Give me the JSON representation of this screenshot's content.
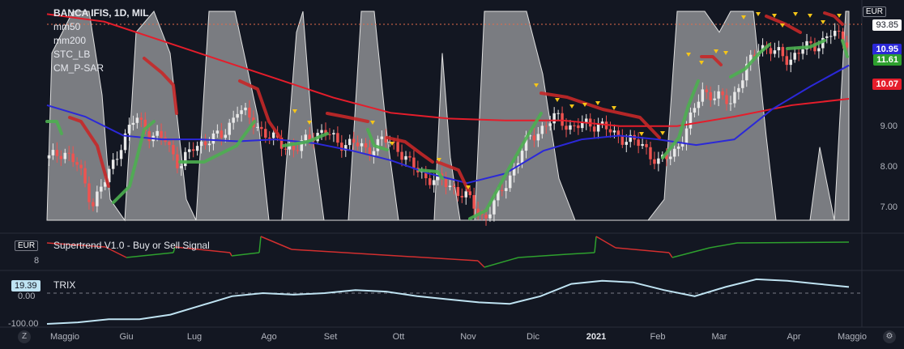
{
  "chart_data": [
    {
      "type": "candlestick",
      "title": "BANCA IFIS, 1D, MIL",
      "currency": "EUR",
      "indicators": [
        "mm50",
        "mm200",
        "STC_LB",
        "CM_P-SAR"
      ],
      "x_ticks": [
        "Maggio",
        "Giu",
        "Lug",
        "Ago",
        "Set",
        "Ott",
        "Nov",
        "Dic",
        "2021",
        "Feb",
        "Mar",
        "Apr",
        "Maggio"
      ],
      "y_ticks": [
        "7.00",
        "8.00",
        "9.00",
        "10.00"
      ],
      "ylim": [
        6.7,
        12.5
      ],
      "last_price": "11.61",
      "mm50_last": "10.95",
      "mm200_last": "10.07",
      "stc_last": "93.85",
      "price_path": [
        8.5,
        8.7,
        8.3,
        7.3,
        8.0,
        8.9,
        9.6,
        9.1,
        9.0,
        8.3,
        8.8,
        9.0,
        9.1,
        9.8,
        9.5,
        9.1,
        8.9,
        8.7,
        9.1,
        9.2,
        8.9,
        8.9,
        8.7,
        9.0,
        8.8,
        8.3,
        8.0,
        7.9,
        7.7,
        7.4,
        6.9,
        7.5,
        8.2,
        9.0,
        9.3,
        9.6,
        9.3,
        9.4,
        9.4,
        9.1,
        9.0,
        8.8,
        8.4,
        8.6,
        9.3,
        10.3,
        10.1,
        10.0,
        10.8,
        11.5,
        11.3,
        11.1,
        11.4,
        11.5,
        11.8,
        11.6
      ],
      "mm50_path": [
        9.9,
        9.6,
        9.1,
        9.0,
        9.0,
        8.95,
        9.0,
        8.9,
        8.7,
        8.45,
        8.1,
        7.85,
        8.1,
        8.7,
        9.0,
        9.1,
        9.0,
        8.85,
        9.0,
        9.8,
        10.4,
        10.95
      ],
      "mm200_path": [
        12.3,
        12.1,
        11.6,
        11.1,
        10.6,
        10.1,
        9.7,
        9.55,
        9.5,
        9.5,
        9.35,
        9.35,
        9.6,
        9.9,
        10.07
      ]
    },
    {
      "type": "line",
      "title": "Supertrend V1.0 - Buy or Sell Signal",
      "currency": "EUR",
      "y_ticks": [
        "8"
      ]
    },
    {
      "type": "line",
      "title": "TRIX",
      "last_value": "19.39",
      "y_ticks": [
        "0.00",
        "-100.00"
      ],
      "series": [
        -100,
        -95,
        -85,
        -85,
        -70,
        -40,
        -10,
        0,
        -5,
        0,
        10,
        5,
        -10,
        -20,
        -30,
        -35,
        -10,
        30,
        40,
        35,
        10,
        -10,
        20,
        45,
        40,
        30,
        20
      ]
    }
  ],
  "colors": {
    "background": "#131722",
    "candle_up": "#e9e9e9",
    "candle_down": "#ef5350",
    "mm50": "#2b28d8",
    "mm200": "#e51d2b",
    "stc": "#cfcfcf",
    "psar": "#f5c518",
    "supertrend_up": "#2ea02e",
    "supertrend_down": "#d32f2f",
    "trix": "#bfe3f2"
  },
  "labels": {
    "stc_badge": "93.85",
    "eur_top": "EUR",
    "mm50_badge": "10.95",
    "price_badge": "11.61",
    "mm200_badge": "10.07",
    "trix_badge": "19.39",
    "eur_mid": "EUR"
  }
}
